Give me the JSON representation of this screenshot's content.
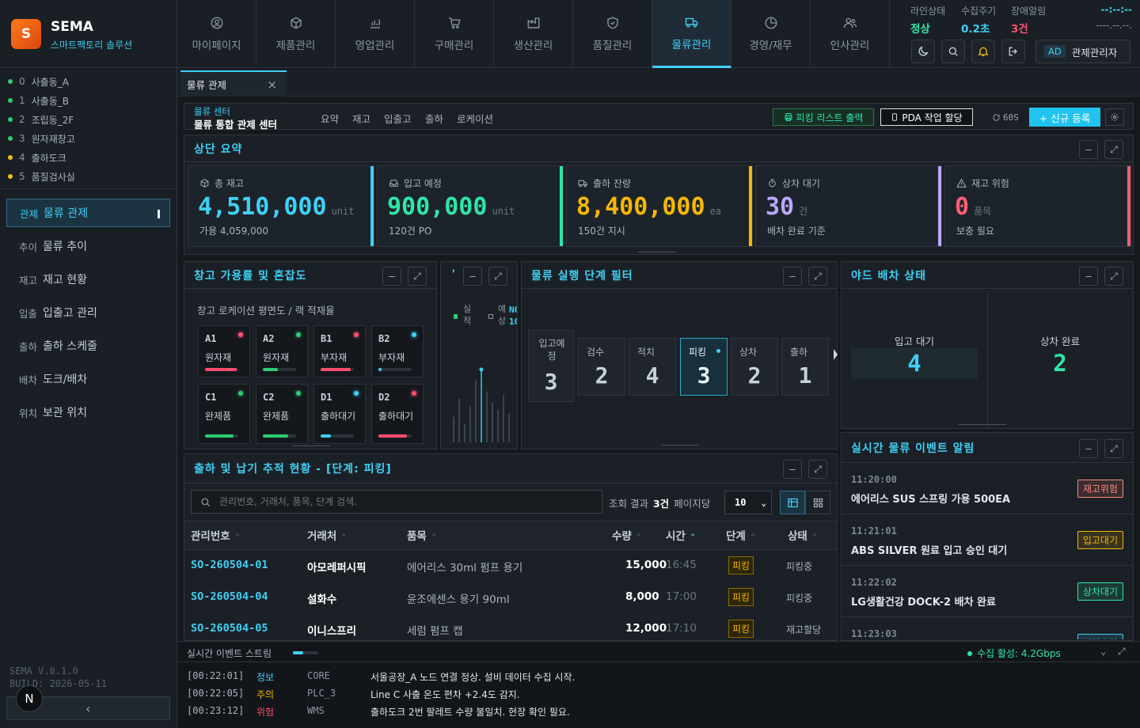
{
  "brand": {
    "logo_letter": "S",
    "name": "SEMA",
    "tagline": "스마트팩토리 솔루션"
  },
  "nav": [
    {
      "label": "마이페이지",
      "icon": "user-icon"
    },
    {
      "label": "제품관리",
      "icon": "box-icon"
    },
    {
      "label": "영업관리",
      "icon": "chart-icon"
    },
    {
      "label": "구매관리",
      "icon": "cart-icon"
    },
    {
      "label": "생산관리",
      "icon": "factory-icon"
    },
    {
      "label": "품질관리",
      "icon": "shield-icon"
    },
    {
      "label": "물류관리",
      "icon": "truck-icon",
      "active": true
    },
    {
      "label": "경영/재무",
      "icon": "pie-icon"
    },
    {
      "label": "인사관리",
      "icon": "people-icon"
    }
  ],
  "status": {
    "line_label": "라인상태",
    "line_value": "정상",
    "cycle_label": "수집주기",
    "cycle_value": "0.2초",
    "alarm_label": "장애알림",
    "alarm_value": "3건",
    "clock_time": "--:--:--",
    "clock_date": "----.--.--."
  },
  "user": {
    "badge": "AD",
    "name": "관제관리자"
  },
  "zones": [
    {
      "code": "0",
      "name": "사출동_A",
      "color": "#2ecc71"
    },
    {
      "code": "1",
      "name": "사출동_B",
      "color": "#2ecc71"
    },
    {
      "code": "2",
      "name": "조립동_2F",
      "color": "#2ecc71"
    },
    {
      "code": "3",
      "name": "원자재창고",
      "color": "#2ecc71"
    },
    {
      "code": "4",
      "name": "출하도크",
      "color": "#f1c40f"
    },
    {
      "code": "5",
      "name": "품질검사실",
      "color": "#f1c40f"
    }
  ],
  "menu": [
    {
      "code": "관제",
      "label": "물류 관제",
      "active": true
    },
    {
      "code": "추이",
      "label": "물류 추이"
    },
    {
      "code": "재고",
      "label": "재고 현황"
    },
    {
      "code": "입출",
      "label": "입출고 관리"
    },
    {
      "code": "출하",
      "label": "출하 스케줄"
    },
    {
      "code": "배차",
      "label": "도크/배차"
    },
    {
      "code": "위치",
      "label": "보관 위치"
    }
  ],
  "version": {
    "ver": "SEMA V.0.1.0",
    "build": "BUILD: 2026-05-11",
    "avatar": "N",
    "collapse": "‹"
  },
  "tab": {
    "label": "물류 관제",
    "close": "×"
  },
  "subheader": {
    "crumb": "물류 센터",
    "title": "물류 통합 관제 센터",
    "links": [
      "요약",
      "재고",
      "입출고",
      "출하",
      "로케이션"
    ],
    "print_btn": "피킹 리스트 출력",
    "pda_btn": "PDA 작업 할당",
    "refresh": "60S",
    "new_btn": "+ 신규 등록"
  },
  "summary": {
    "title": "상단 요약",
    "cards": [
      {
        "label": "총 재고",
        "value": "4,510,000",
        "unit": "unit",
        "sub": "가용 4,059,000",
        "color": "#3fd0f5",
        "icon": "box-icon"
      },
      {
        "label": "입고 예정",
        "value": "900,000",
        "unit": "unit",
        "sub": "120건 PO",
        "color": "#2ee6a8",
        "icon": "inbox-icon"
      },
      {
        "label": "출하 잔량",
        "value": "8,400,000",
        "unit": "ea",
        "sub": "150건 지시",
        "color": "#f5b800",
        "icon": "truck-icon"
      },
      {
        "label": "상차 대기",
        "value": "30",
        "unit": "건",
        "sub": "배차 완료 기준",
        "color": "#b9a8ff",
        "icon": "timer-icon"
      },
      {
        "label": "재고 위험",
        "value": "0",
        "unit": "품목",
        "sub": "보충 필요",
        "color": "#ff5d73",
        "icon": "warning-icon"
      }
    ]
  },
  "warehouse": {
    "title": "창고 가용률 및 혼잡도",
    "subtitle": "창고 로케이션 평면도 / 랙 적재율",
    "racks": [
      {
        "id": "A1",
        "name": "원자재",
        "dot": "#ff4d6d",
        "bar": "#ff4d6d",
        "fill": 0.95
      },
      {
        "id": "A2",
        "name": "원자재",
        "dot": "#2ecc71",
        "bar": "#2ecc71",
        "fill": 0.45
      },
      {
        "id": "B1",
        "name": "부자재",
        "dot": "#ff4d6d",
        "bar": "#ff4d6d",
        "fill": 0.9
      },
      {
        "id": "B2",
        "name": "부자재",
        "dot": "#3fd0f5",
        "bar": "#3fd0f5",
        "fill": 0.1
      },
      {
        "id": "C1",
        "name": "완제품",
        "dot": "#2ecc71",
        "bar": "#2ecc71",
        "fill": 0.85
      },
      {
        "id": "C2",
        "name": "완제품",
        "dot": "#2ecc71",
        "bar": "#2ecc71",
        "fill": 0.75
      },
      {
        "id": "D1",
        "name": "출하대기",
        "dot": "#3fd0f5",
        "bar": "#3fd0f5",
        "fill": 0.3
      },
      {
        "id": "D2",
        "name": "출하대기",
        "dot": "#ff4d6d",
        "bar": "#ff4d6d",
        "fill": 0.85
      }
    ]
  },
  "mini": {
    "title": "’",
    "legend_actual": "실적",
    "legend_plan": "예상",
    "tag1": "N0",
    "tag2": "10"
  },
  "stages": {
    "title": "물류 실행 단계 필터",
    "items": [
      {
        "label": "입고예정",
        "value": "3"
      },
      {
        "label": "검수",
        "value": "2"
      },
      {
        "label": "적치",
        "value": "4"
      },
      {
        "label": "피킹",
        "value": "3",
        "selected": true
      },
      {
        "label": "상차",
        "value": "2"
      },
      {
        "label": "출하",
        "value": "1"
      }
    ]
  },
  "yard": {
    "title": "야드 배차 상태",
    "left_label": "입고 대기",
    "left_value": "4",
    "right_label": "상차 완료",
    "right_value": "2"
  },
  "tracking": {
    "title": "출하 및 납기 추적 현황 - [단계: 피킹]",
    "search_placeholder": "관리번호, 거래처, 품목, 단계 검색.",
    "result_prefix": "조회 결과",
    "result_count": "3건",
    "per_page_label": "페이지당",
    "per_page": "10",
    "columns": [
      "관리번호",
      "거래처",
      "품목",
      "수량",
      "시간",
      "단계",
      "상태"
    ],
    "rows": [
      {
        "id": "SO-260504-01",
        "client": "아모레퍼시픽",
        "item": "에어리스 30ml 펌프 용기",
        "qty": "15,000",
        "time": "16:45",
        "stage": "피킹",
        "status": "피킹중"
      },
      {
        "id": "SO-260504-04",
        "client": "설화수",
        "item": "윤조에센스 용기 90ml",
        "qty": "8,000",
        "time": "17:00",
        "stage": "피킹",
        "status": "피킹중"
      },
      {
        "id": "SO-260504-05",
        "client": "이니스프리",
        "item": "세럼 펌프 캡",
        "qty": "12,000",
        "time": "17:10",
        "stage": "피킹",
        "status": "재고할당"
      }
    ]
  },
  "events": {
    "title": "실시간 물류 이벤트 알림",
    "items": [
      {
        "time": "11:20:00",
        "text": "에어리스 SUS 스프링 가용 500EA",
        "badge": "재고위험",
        "color": "#ff8a7a"
      },
      {
        "time": "11:21:01",
        "text": "ABS SILVER 원료 입고 승인 대기",
        "badge": "입고대기",
        "color": "#f5b800"
      },
      {
        "time": "11:22:02",
        "text": "LG생활건강 DOCK-2 배차 완료",
        "badge": "상차대기",
        "color": "#2ee6a8"
      },
      {
        "time": "11:23:03",
        "text": "",
        "badge": "피킹오차",
        "color": "#3fd0f5"
      }
    ]
  },
  "stream": {
    "title": "실시간 이벤트 스트림",
    "status": "수집 활성: 4.2Gbps",
    "logs": [
      {
        "time": "[00:22:01]",
        "level": "정보",
        "color": "#3fd0f5",
        "src": "CORE",
        "msg": "서울공장_A 노드 연결 정상. 설비 데이터 수집 시작."
      },
      {
        "time": "[00:22:05]",
        "level": "주의",
        "color": "#f5b800",
        "src": "PLC_3",
        "msg": "Line C 사출 온도 편차 +2.4도 감지."
      },
      {
        "time": "[00:23:12]",
        "level": "위험",
        "color": "#ff4d6d",
        "src": "WMS",
        "msg": "출하도크 2번 팔레트 수량 불일치. 현장 확인 필요."
      }
    ]
  },
  "mini_chart_data": {
    "type": "bar",
    "values": [
      0.35,
      0.6,
      0.25,
      0.5,
      0.85,
      1.0,
      0.7,
      0.55,
      0.45,
      0.65,
      0.4
    ]
  }
}
